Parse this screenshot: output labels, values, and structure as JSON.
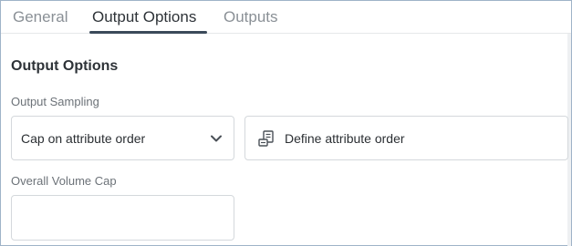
{
  "tabs": [
    {
      "label": "General",
      "active": false
    },
    {
      "label": "Output Options",
      "active": true
    },
    {
      "label": "Outputs",
      "active": false
    }
  ],
  "section": {
    "title": "Output Options"
  },
  "output_sampling": {
    "label": "Output Sampling",
    "selected": "Cap on attribute order",
    "icon": "chevron-down-icon"
  },
  "define_button": {
    "label": "Define attribute order",
    "icon": "attribute-order-icon"
  },
  "overall_volume_cap": {
    "label": "Overall Volume Cap",
    "value": "",
    "placeholder": ""
  },
  "colors": {
    "active_tab_underline": "#3b4a5a",
    "border": "#d4d8dc",
    "frame_border": "#9fb3c8"
  }
}
